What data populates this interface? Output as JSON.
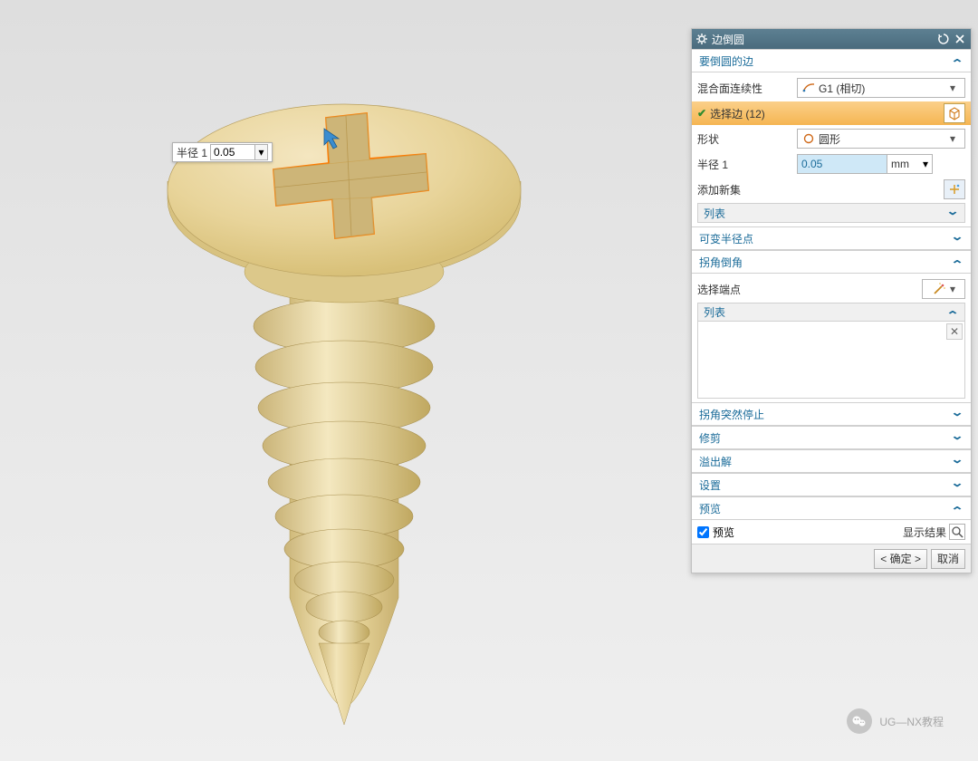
{
  "dialog": {
    "title": "边倒圆",
    "sections": {
      "edges": {
        "title": "要倒圆的边",
        "blend_continuity_label": "混合面连续性",
        "blend_continuity_value": "G1 (相切)",
        "select_edges_label": "选择边 (12)",
        "shape_label": "形状",
        "shape_value": "圆形",
        "radius_label": "半径 1",
        "radius_value": "0.05",
        "radius_unit": "mm",
        "add_new_set_label": "添加新集",
        "list_label": "列表"
      },
      "variable_radius": {
        "title": "可变半径点"
      },
      "corner_setback": {
        "title": "拐角倒角",
        "select_endpoint_label": "选择端点",
        "list_label": "列表"
      },
      "corner_stop": {
        "title": "拐角突然停止"
      },
      "trim": {
        "title": "修剪"
      },
      "overflow": {
        "title": "溢出解"
      },
      "settings": {
        "title": "设置"
      },
      "preview": {
        "title": "预览",
        "checkbox_label": "预览",
        "show_result_label": "显示结果"
      }
    },
    "buttons": {
      "ok": "< 确定 >",
      "cancel": "取消"
    }
  },
  "floating": {
    "label": "半径 1",
    "value": "0.05"
  },
  "watermark": {
    "text": "UG—NX教程"
  }
}
